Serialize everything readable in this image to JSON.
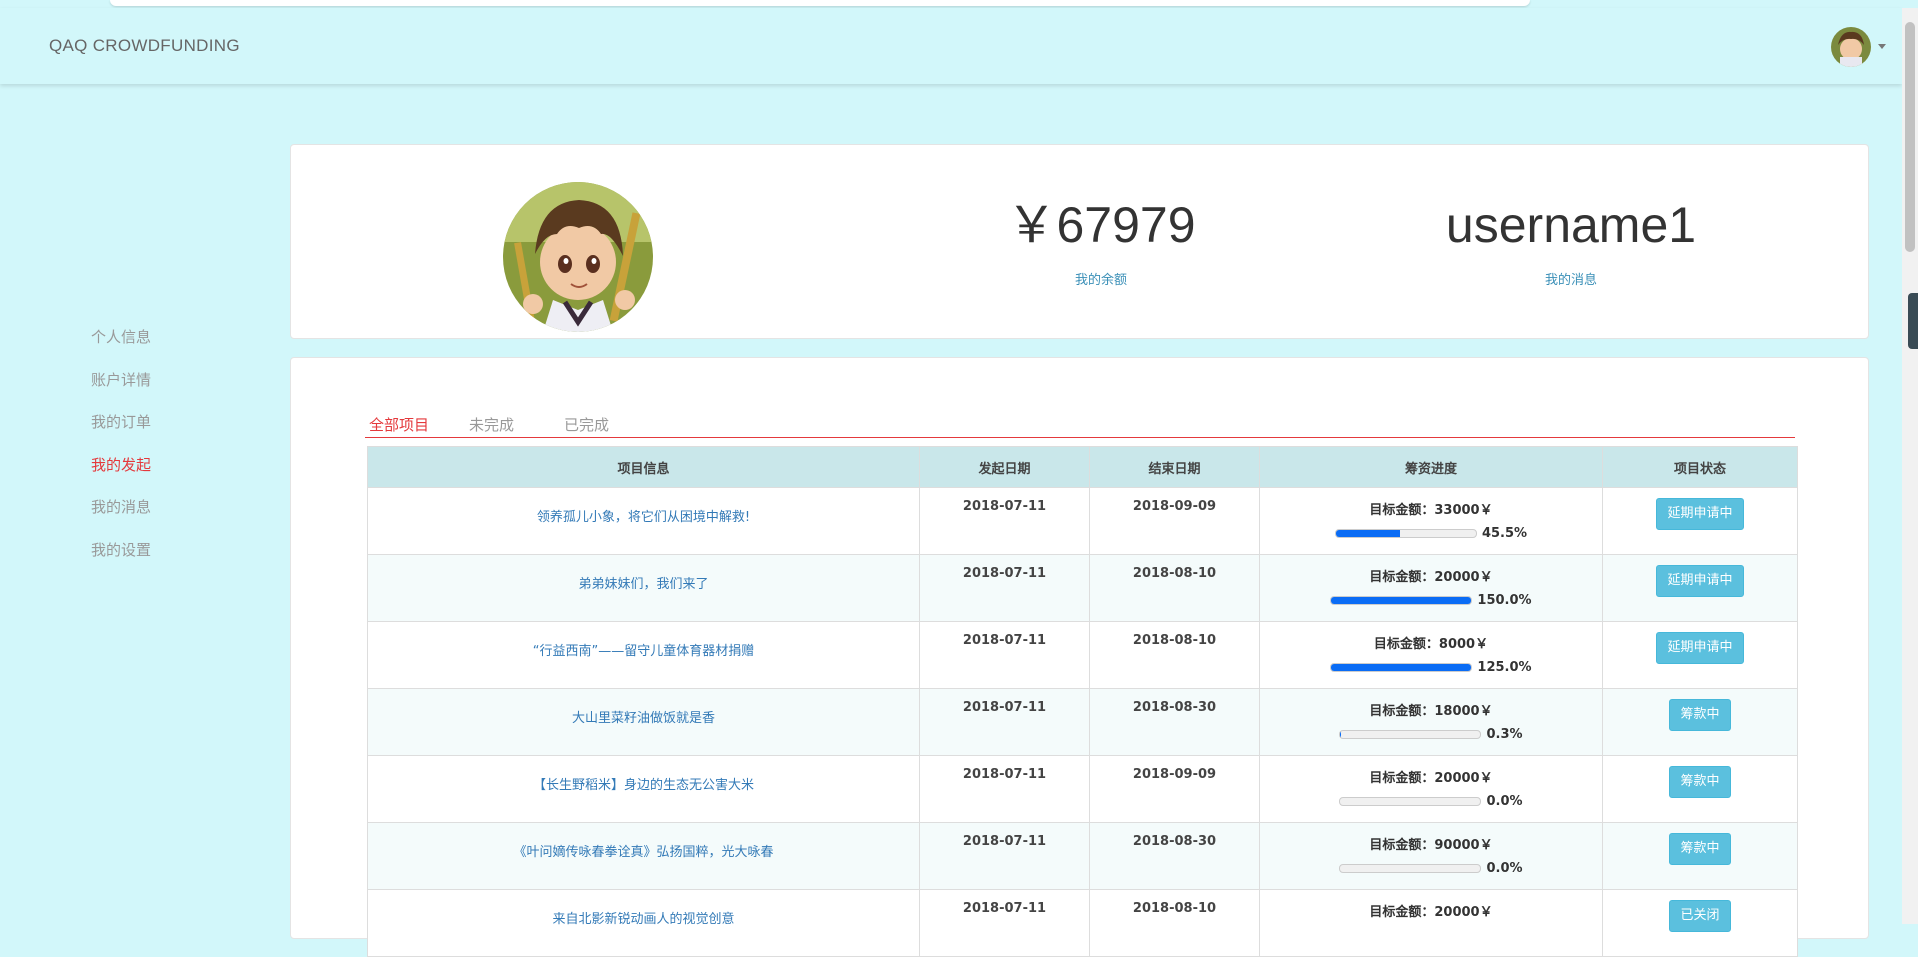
{
  "app": {
    "brand": "QAQ CROWDFUNDING"
  },
  "sidebar": {
    "items": [
      {
        "label": "个人信息"
      },
      {
        "label": "账户详情"
      },
      {
        "label": "我的订单"
      },
      {
        "label": "我的发起",
        "active": true
      },
      {
        "label": "我的消息"
      },
      {
        "label": "我的设置"
      }
    ]
  },
  "profile": {
    "balance": "￥67979",
    "balance_label": "我的余额",
    "username": "username1",
    "username_label": "我的消息"
  },
  "tabs": [
    {
      "label": "全部项目",
      "active": true
    },
    {
      "label": "未完成"
    },
    {
      "label": "已完成"
    }
  ],
  "table": {
    "headers": [
      "项目信息",
      "发起日期",
      "结束日期",
      "筹资进度",
      "项目状态"
    ],
    "rows": [
      {
        "title": "领养孤儿小象，将它们从困境中解救!",
        "start": "2018-07-11",
        "end": "2018-09-09",
        "goal": "目标金额：33000￥",
        "progress": 45.5,
        "pct": "45.5%",
        "status": "延期申请中"
      },
      {
        "title": "弟弟妹妹们，我们来了",
        "start": "2018-07-11",
        "end": "2018-08-10",
        "goal": "目标金额：20000￥",
        "progress": 150.0,
        "pct": "150.0%",
        "status": "延期申请中"
      },
      {
        "title": "“行益西南”——留守儿童体育器材捐赠",
        "start": "2018-07-11",
        "end": "2018-08-10",
        "goal": "目标金额：8000￥",
        "progress": 125.0,
        "pct": "125.0%",
        "status": "延期申请中"
      },
      {
        "title": "大山里菜籽油做饭就是香",
        "start": "2018-07-11",
        "end": "2018-08-30",
        "goal": "目标金额：18000￥",
        "progress": 0.3,
        "pct": "0.3%",
        "status": "筹款中"
      },
      {
        "title": "【长生野稻米】身边的生态无公害大米",
        "start": "2018-07-11",
        "end": "2018-09-09",
        "goal": "目标金额：20000￥",
        "progress": 0.0,
        "pct": "0.0%",
        "status": "筹款中"
      },
      {
        "title": "《叶问嫡传咏春拳诠真》弘扬国粹，光大咏春",
        "start": "2018-07-11",
        "end": "2018-08-30",
        "goal": "目标金额：90000￥",
        "progress": 0.0,
        "pct": "0.0%",
        "status": "筹款中"
      },
      {
        "title": "来自北影新锐动画人的视觉创意",
        "start": "2018-07-11",
        "end": "2018-08-10",
        "goal": "目标金额：20000￥",
        "progress": null,
        "pct": "",
        "status": "已关闭"
      }
    ]
  },
  "colors": {
    "background": "#d2f7fa",
    "accent": "#e4393c",
    "progress": "#0a6cf5",
    "status_button": "#5bc0de",
    "link": "#337ab7"
  }
}
